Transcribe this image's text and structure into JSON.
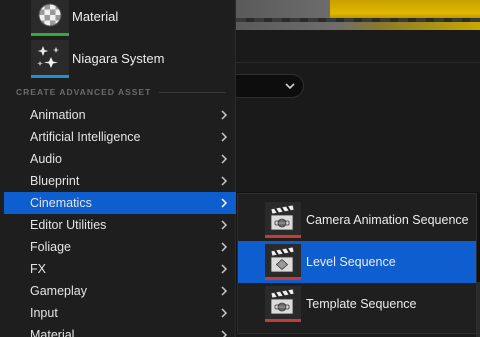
{
  "top_assets": [
    {
      "label": "Material",
      "icon": "material-sphere-icon",
      "accent": "#3aa53a"
    },
    {
      "label": "Niagara System",
      "icon": "niagara-sparkle-icon",
      "accent": "#1f8fd6"
    }
  ],
  "section_header": "CREATE ADVANCED ASSET",
  "categories": [
    {
      "label": "Animation"
    },
    {
      "label": "Artificial Intelligence"
    },
    {
      "label": "Audio"
    },
    {
      "label": "Blueprint"
    },
    {
      "label": "Cinematics"
    },
    {
      "label": "Editor Utilities"
    },
    {
      "label": "Foliage"
    },
    {
      "label": "FX"
    },
    {
      "label": "Gameplay"
    },
    {
      "label": "Input"
    },
    {
      "label": "Material"
    }
  ],
  "selected_category": "Cinematics",
  "submenu": [
    {
      "label": "Camera Animation Sequence",
      "icon": "clapperboard-camera-icon"
    },
    {
      "label": "Level Sequence",
      "icon": "clapperboard-level-icon"
    },
    {
      "label": "Template Sequence",
      "icon": "clapperboard-template-icon"
    }
  ],
  "selected_submenu": "Level Sequence",
  "colors": {
    "selection": "#0e5ecf",
    "menu_bg": "#1e1e1e",
    "sequence_accent": "#c83a3a"
  }
}
